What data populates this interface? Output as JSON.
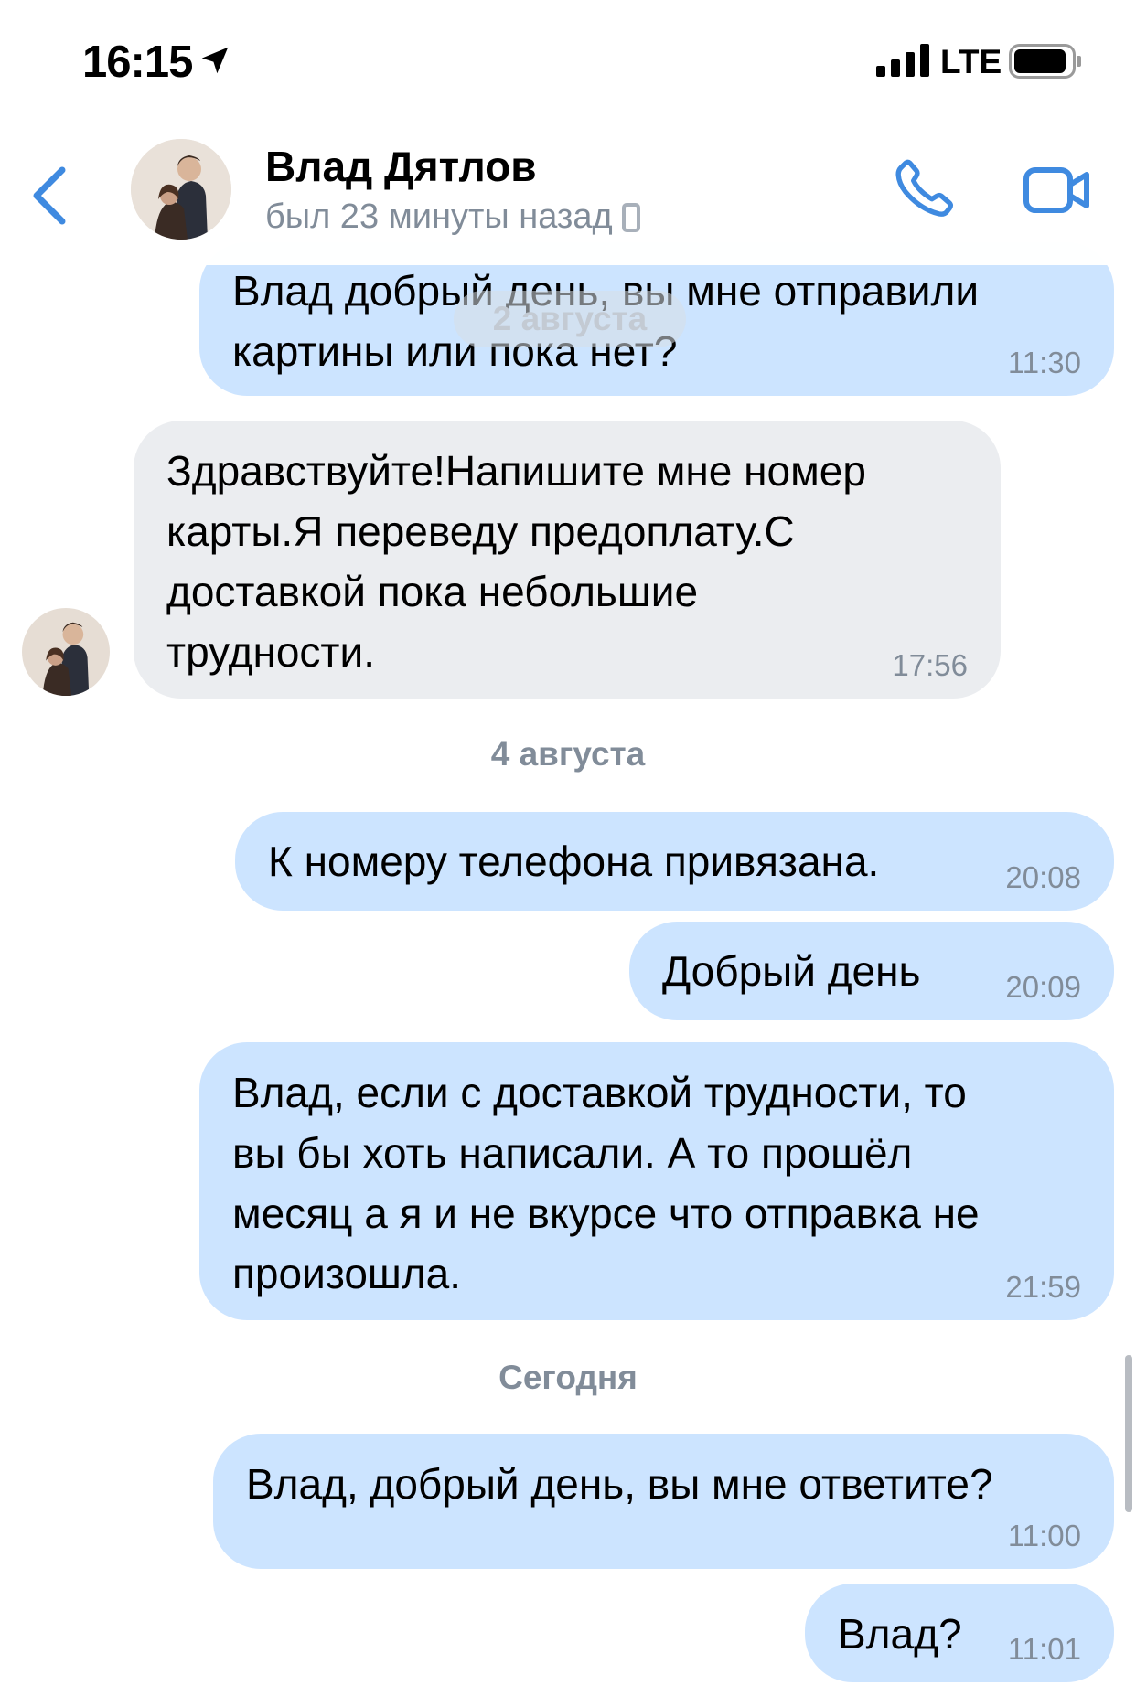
{
  "status_bar": {
    "time": "16:15",
    "network": "LTE"
  },
  "header": {
    "contact_name": "Влад Дятлов",
    "last_seen": "был 23 минуты назад"
  },
  "floating_date": "2 августа",
  "messages": [
    {
      "direction": "out",
      "text": "Влад добрый день, вы мне отправили\nкартины или пока нет?",
      "time": "11:30"
    },
    {
      "direction": "in",
      "text": "Здравствуйте!Напишите мне номер\nкарты.Я переведу предоплату.С\nдоставкой пока небольшие\nтрудности.",
      "time": "17:56"
    },
    {
      "direction": "out",
      "text": "К номеру телефона привязана.",
      "time": "20:08"
    },
    {
      "direction": "out",
      "text": "Добрый день",
      "time": "20:09"
    },
    {
      "direction": "out",
      "text": "Влад, если с доставкой трудности, то\nвы бы хоть написали. А то прошёл\nмесяц а я и не вкурсе что отправка не\nпроизошла.",
      "time": "21:59"
    },
    {
      "direction": "out",
      "text": "Влад, добрый день, вы мне ответите?",
      "time": "11:00"
    },
    {
      "direction": "out",
      "text": "Влад?",
      "time": "11:01"
    }
  ],
  "date_separators": [
    "4 августа",
    "Сегодня"
  ],
  "colors": {
    "accent": "#3f8ae0",
    "outgoing_bubble": "#cce4ff",
    "incoming_bubble": "#ebedf0",
    "secondary_text": "#818c99"
  }
}
